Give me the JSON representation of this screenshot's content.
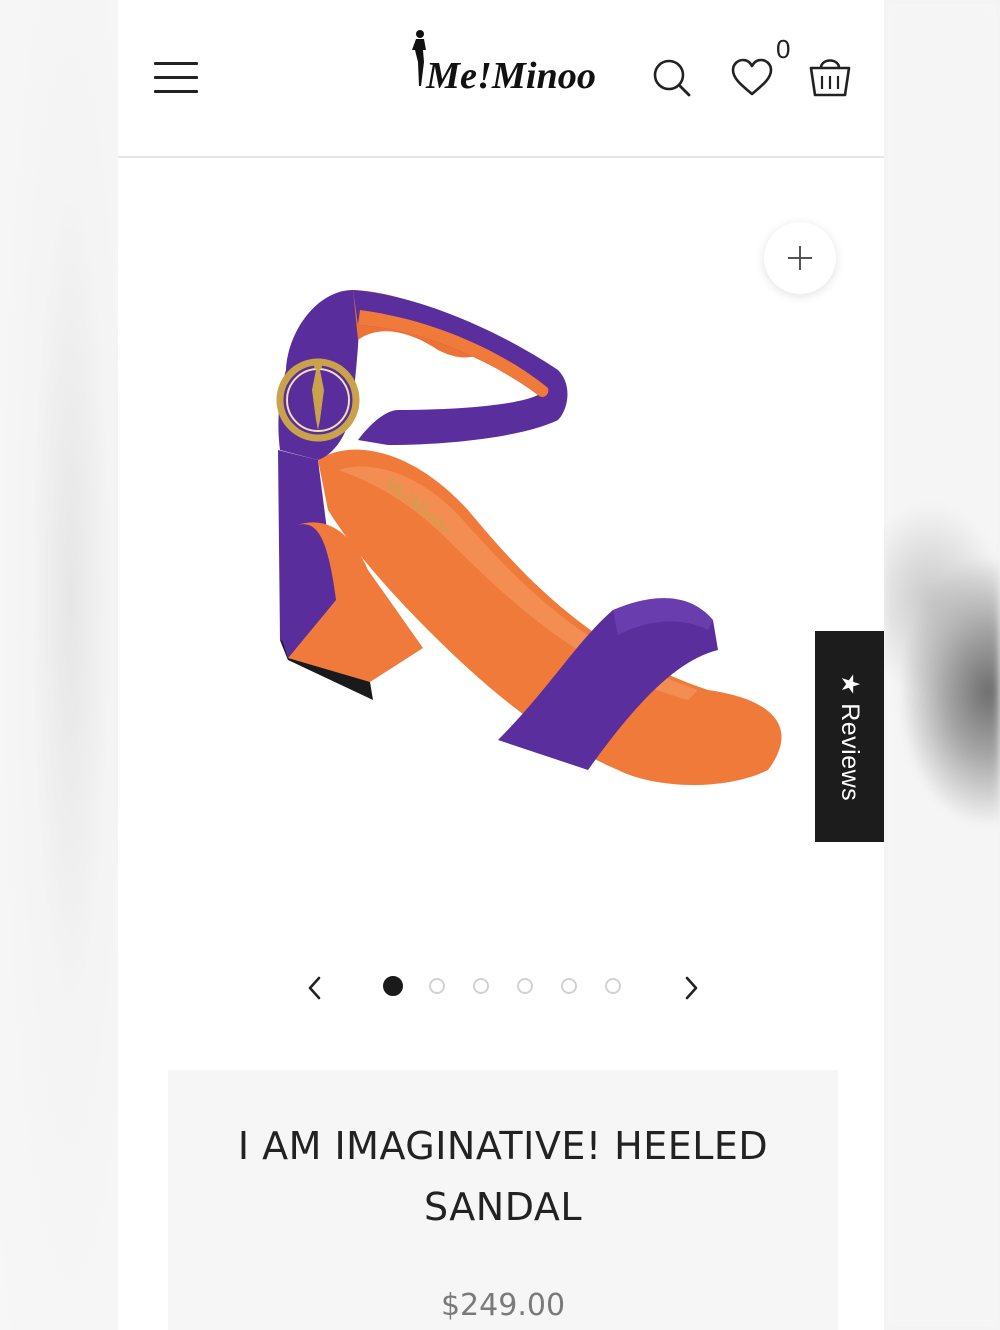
{
  "header": {
    "brand": "Me!Minoo",
    "wishlist_count": "0"
  },
  "gallery": {
    "total_images": 6,
    "active_index": 0,
    "product_image_alt": "Purple and orange heeled sandal with gold logo buckle"
  },
  "reviews_tab": {
    "label": "★ Reviews"
  },
  "product": {
    "title": "I AM IMAGINATIVE! HEELED SANDAL",
    "title_line1": "I AM IMAGINATIVE! HEELED",
    "title_line2": "SANDAL",
    "price": "$249.00"
  },
  "colors": {
    "shoe_upper": "#5a2d9c",
    "shoe_lining": "#f07a3a",
    "buckle": "#c9a24a",
    "reviews_tab_bg": "#1c1c1c",
    "info_bg": "#f6f6f7"
  },
  "icons": {
    "menu": "hamburger-icon",
    "search": "search-icon",
    "wishlist": "heart-icon",
    "cart": "shopping-bag-icon",
    "zoom": "plus-icon",
    "prev": "chevron-left-icon",
    "next": "chevron-right-icon"
  }
}
